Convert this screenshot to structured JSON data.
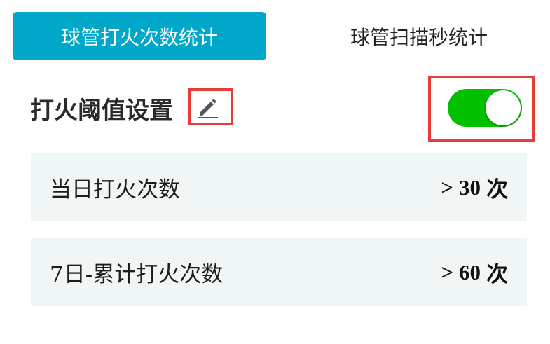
{
  "tabs": [
    {
      "label": "球管打火次数统计",
      "active": true
    },
    {
      "label": "球管扫描秒统计",
      "active": false
    }
  ],
  "threshold": {
    "title": "打火阈值设置",
    "edit_icon": "pencil-icon",
    "toggle_on": true
  },
  "stats": [
    {
      "label": "当日打火次数",
      "comparator": ">",
      "value": "30",
      "unit": "次"
    },
    {
      "label": "7日-累计打火次数",
      "comparator": ">",
      "value": "60",
      "unit": "次"
    }
  ],
  "colors": {
    "tab_active_bg": "#00a7c8",
    "toggle_on": "#00c000",
    "highlight_border": "#ea3b3b",
    "row_bg": "#f0f5f6"
  }
}
